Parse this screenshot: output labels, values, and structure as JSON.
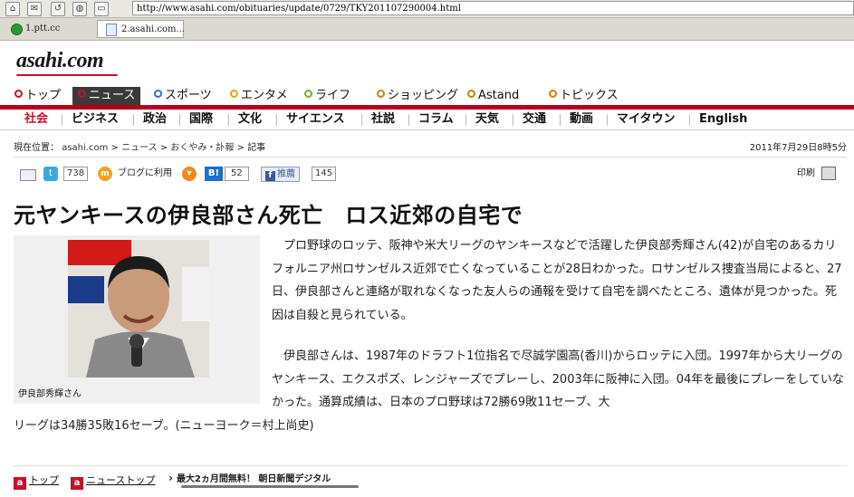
{
  "browser": {
    "url": "http://www.asahi.com/obituaries/update/0729/TKY201107290004.html",
    "tabs": [
      {
        "label": "1.ptt.cc"
      },
      {
        "label": "2.asahi.com..."
      }
    ]
  },
  "site": {
    "logo_text": "asahi.com",
    "brand_color": "#c8102e"
  },
  "main_nav": [
    {
      "label": "トップ",
      "ring": "#c8102e"
    },
    {
      "label": "ニュース",
      "ring": "#c8102e",
      "active": true
    },
    {
      "label": "スポーツ",
      "ring": "#2a6fd6"
    },
    {
      "label": "エンタメ",
      "ring": "#e6a400"
    },
    {
      "label": "ライフ",
      "ring": "#7cae1f"
    },
    {
      "label": "ショッピング",
      "ring": "#e07b00"
    },
    {
      "label": "Astand",
      "ring": "#b38a00"
    },
    {
      "label": "トピックス",
      "ring": "#e07b00"
    }
  ],
  "sub_nav": [
    "社会",
    "ビジネス",
    "政治",
    "国際",
    "文化",
    "サイエンス",
    "社説",
    "コラム",
    "天気",
    "交通",
    "動画",
    "マイタウン",
    "English"
  ],
  "breadcrumb": {
    "prefix": "現在位置：",
    "items": [
      "asahi.com",
      "ニュース",
      "おくやみ・訃報",
      "記事"
    ],
    "sep": ">"
  },
  "datetime": "2011年7月29日8時5分",
  "social": {
    "twitter_count": "738",
    "blog_label": "ブログに利用",
    "hatena_count": "52",
    "fb_label": "推薦",
    "fb_count": "145",
    "print_label": "印刷"
  },
  "article": {
    "headline": "元ヤンキースの伊良部さん死亡　ロス近郊の自宅で",
    "caption": "伊良部秀輝さん",
    "p1": "プロ野球のロッテ、阪神や米大リーグのヤンキースなどで活躍した伊良部秀輝さん(42)が自宅のあるカリフォルニア州ロサンゼルス近郊で亡くなっていることが28日わかった。ロサンゼルス捜査当局によると、27日、伊良部さんと連絡が取れなくなった友人らの通報を受けて自宅を調べたところ、遺体が見つかった。死因は自殺と見られている。",
    "p2a": "伊良部さんは、1987年のドラフト1位指名で尽誠学園高(香川)からロッテに入団。1997年から大リーグのヤンキース、エクスポズ、レンジャーズでプレーし、2003年に阪神に入団。04年を最後にプレーをしていなかった。通算成績は、日本のプロ野球は72勝69敗11セーブ、大",
    "p2b": "リーグは34勝35敗16セーブ。(ニューヨーク＝村上尚史)"
  },
  "footer": {
    "top_link": "トップ",
    "news_top_link": "ニューストップ",
    "promo": "最大2ヵ月間無料！ 朝日新聞デジタル",
    "icon_letter": "a"
  }
}
